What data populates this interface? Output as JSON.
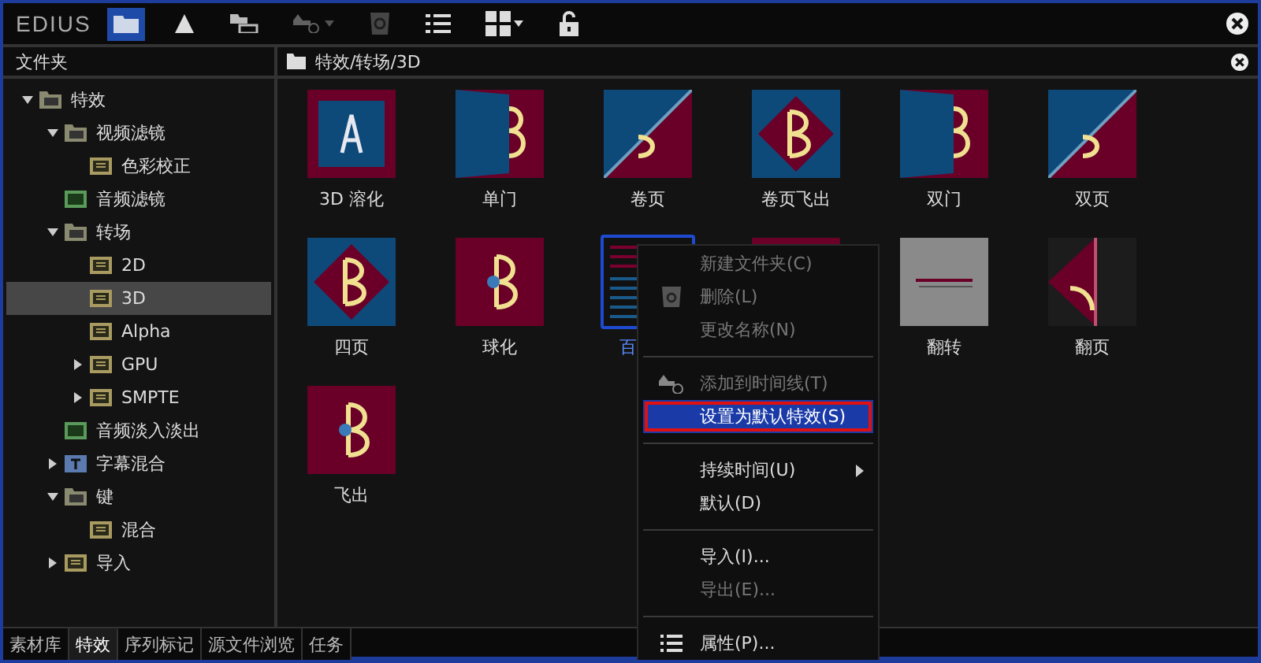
{
  "toolbar": {
    "logo": "EDIUS",
    "buttons": [
      {
        "selected": true,
        "disabled": false
      },
      {
        "selected": false,
        "disabled": false
      },
      {
        "selected": false,
        "disabled": false
      },
      {
        "selected": false,
        "disabled": true
      },
      {
        "selected": false,
        "disabled": true
      },
      {
        "selected": false,
        "disabled": false
      },
      {
        "selected": false,
        "disabled": false
      },
      {
        "selected": false,
        "disabled": false
      }
    ]
  },
  "folder_pane": {
    "title": "文件夹",
    "tree": [
      {
        "label": "特效",
        "kind": "folder",
        "expanded": true,
        "selected": false,
        "children": [
          {
            "label": "视频滤镜",
            "kind": "folder",
            "expanded": true,
            "selected": false,
            "children": [
              {
                "label": "色彩校正",
                "kind": "effect",
                "selected": false
              }
            ]
          },
          {
            "label": "音频滤镜",
            "kind": "audio",
            "selected": false
          },
          {
            "label": "转场",
            "kind": "folder",
            "expanded": true,
            "selected": false,
            "children": [
              {
                "label": "2D",
                "kind": "effect",
                "selected": false
              },
              {
                "label": "3D",
                "kind": "effect",
                "selected": true
              },
              {
                "label": "Alpha",
                "kind": "effect",
                "selected": false
              },
              {
                "label": "GPU",
                "kind": "effect",
                "expanded": false,
                "selected": false
              },
              {
                "label": "SMPTE",
                "kind": "effect",
                "expanded": false,
                "selected": false
              }
            ]
          },
          {
            "label": "音频淡入淡出",
            "kind": "audio",
            "selected": false
          },
          {
            "label": "字幕混合",
            "kind": "title",
            "expanded": false,
            "selected": false
          },
          {
            "label": "键",
            "kind": "folder",
            "expanded": true,
            "selected": false,
            "children": [
              {
                "label": "混合",
                "kind": "effect",
                "selected": false
              }
            ]
          },
          {
            "label": "导入",
            "kind": "effect",
            "expanded": false,
            "selected": false
          }
        ]
      }
    ]
  },
  "bottom_tabs": [
    {
      "label": "素材库",
      "selected": false
    },
    {
      "label": "特效",
      "selected": true
    },
    {
      "label": "序列标记",
      "selected": false
    },
    {
      "label": "源文件浏览",
      "selected": false
    },
    {
      "label": "任务",
      "selected": false
    }
  ],
  "effects_pane": {
    "path": "特效/转场/3D",
    "items": [
      {
        "label": "3D 溶化",
        "kind": "square",
        "selected": false
      },
      {
        "label": "单门",
        "kind": "door",
        "selected": false
      },
      {
        "label": "卷页",
        "kind": "split",
        "selected": false
      },
      {
        "label": "卷页飞出",
        "kind": "diamond",
        "selected": false
      },
      {
        "label": "双门",
        "kind": "door",
        "selected": false
      },
      {
        "label": "双页",
        "kind": "split",
        "selected": false
      },
      {
        "label": "四页",
        "kind": "diamond",
        "selected": false
      },
      {
        "label": "球化",
        "kind": "maroon",
        "selected": false
      },
      {
        "label": "百",
        "kind": "stripes",
        "selected": true
      },
      {
        "kind": "square",
        "selected": false
      },
      {
        "label": "翻转",
        "kind": "grey",
        "selected": false
      },
      {
        "label": "翻页",
        "kind": "dark",
        "selected": false
      },
      {
        "label": "飞出",
        "kind": "maroon",
        "selected": false
      }
    ]
  },
  "context_menu": [
    {
      "kind": "item",
      "label": "新建文件夹(C)",
      "disabled": true,
      "highlighted": false,
      "outlined": false,
      "submenu": false
    },
    {
      "kind": "item",
      "label": "删除(L)",
      "disabled": true,
      "highlighted": false,
      "outlined": false,
      "submenu": false
    },
    {
      "kind": "item",
      "label": "更改名称(N)",
      "disabled": true,
      "highlighted": false,
      "outlined": false,
      "submenu": false
    },
    {
      "kind": "separator"
    },
    {
      "kind": "item",
      "label": "添加到时间线(T)",
      "disabled": true,
      "highlighted": false,
      "outlined": false,
      "submenu": false
    },
    {
      "kind": "item",
      "label": "设置为默认特效(S)",
      "disabled": false,
      "highlighted": true,
      "outlined": true,
      "submenu": false
    },
    {
      "kind": "separator"
    },
    {
      "kind": "item",
      "label": "持续时间(U)",
      "disabled": false,
      "highlighted": false,
      "outlined": false,
      "submenu": true
    },
    {
      "kind": "item",
      "label": "默认(D)",
      "disabled": false,
      "highlighted": false,
      "outlined": false,
      "submenu": false
    },
    {
      "kind": "separator"
    },
    {
      "kind": "item",
      "label": "导入(I)...",
      "disabled": false,
      "highlighted": false,
      "outlined": false,
      "submenu": false
    },
    {
      "kind": "item",
      "label": "导出(E)...",
      "disabled": true,
      "highlighted": false,
      "outlined": false,
      "submenu": false
    },
    {
      "kind": "separator"
    },
    {
      "kind": "item",
      "label": "属性(P)...",
      "disabled": false,
      "highlighted": false,
      "outlined": false,
      "submenu": false
    }
  ]
}
